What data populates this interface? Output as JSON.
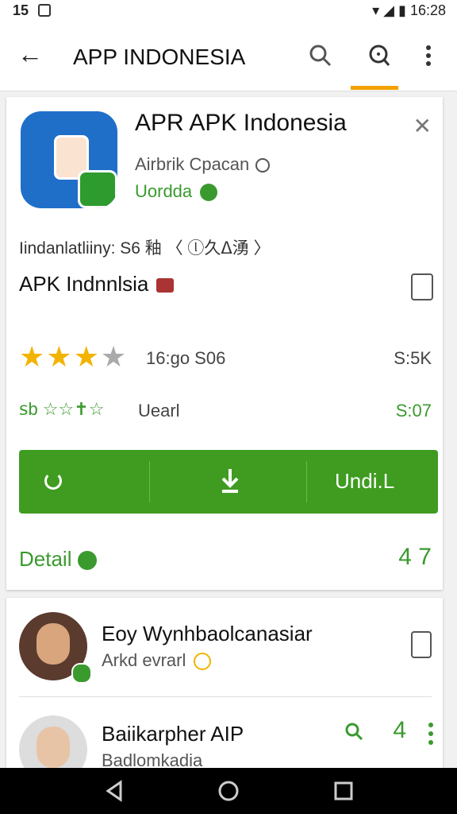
{
  "status": {
    "time": "15",
    "right_time": "16:28"
  },
  "appbar": {
    "title": "APP INDONESIA"
  },
  "app": {
    "name": "APR APK Indonesia",
    "developer": "Airbrik Cpacan",
    "category": "Uordda",
    "info_line": "Iindanlatliiny: S6  釉 〈 ⓛ久ᐃ湧 〉",
    "apk_name": "APK Indnnlsia",
    "rating_text": "16:go S06",
    "rating_count": "S:5K",
    "rating_stars": 3,
    "green_stars": "ꜱb ☆☆✝☆",
    "green_label": "Uearl",
    "green_num": "S:07",
    "action_label": "Undi.L",
    "detail_label": "Detail",
    "detail_num": "4 7"
  },
  "users": [
    {
      "name": "Eoy Wynhbaolcanasiar",
      "sub": "Arkd evrarl"
    },
    {
      "name": "Baiikarpher AIP",
      "sub": "Badlomkadia",
      "num": "4"
    }
  ],
  "colors": {
    "green": "#3f9c21",
    "accent": "#f2a100",
    "star": "#f2b400"
  },
  "icons": [
    "back-arrow-icon",
    "search-icon",
    "search-active-icon",
    "more-vert-icon",
    "close-icon",
    "clock-icon",
    "check-icon",
    "document-icon",
    "refresh-icon",
    "download-icon",
    "share-icon",
    "warning-icon",
    "nav-back-icon",
    "nav-home-icon",
    "nav-recents-icon"
  ]
}
